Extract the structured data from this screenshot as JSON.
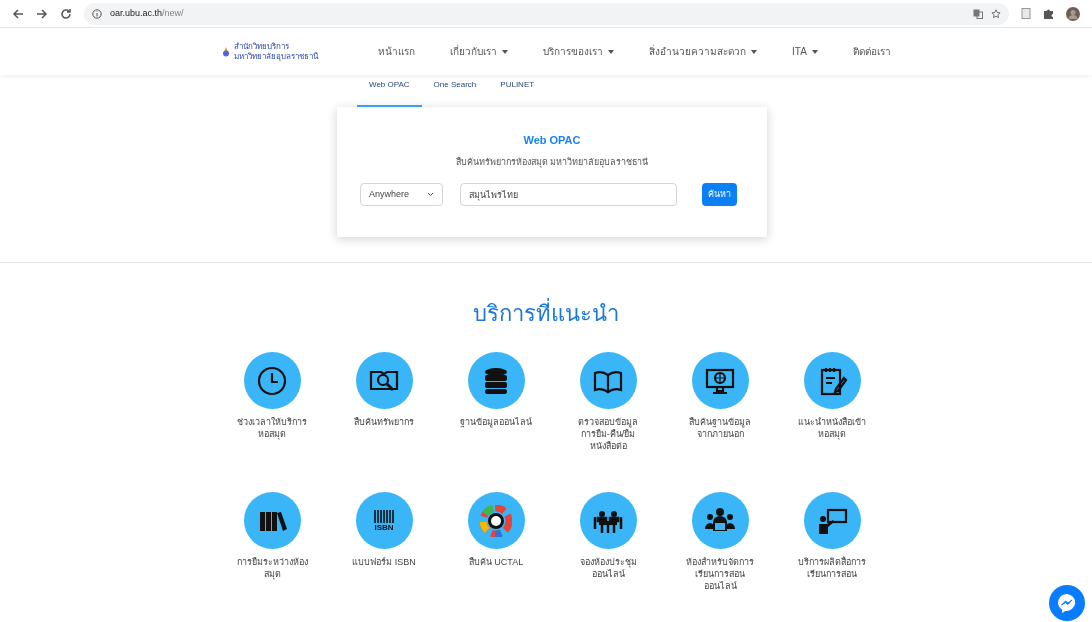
{
  "browser": {
    "url_host": "oar.ubu.ac.th",
    "url_path": "/new/"
  },
  "logo": {
    "line_1": "สำนักวิทยบริการ",
    "line_2": "มหาวิทยาลัยอุบลราชธานี"
  },
  "nav": [
    {
      "label": "หน้าแรก",
      "dropdown": false
    },
    {
      "label": "เกี่ยวกับเรา",
      "dropdown": true
    },
    {
      "label": "บริการของเรา",
      "dropdown": true
    },
    {
      "label": "สิ่งอำนวยความสะดวก",
      "dropdown": true
    },
    {
      "label": "ITA",
      "dropdown": true
    },
    {
      "label": "ติดต่อเรา",
      "dropdown": false
    }
  ],
  "search_tabs": [
    {
      "label": "Web OPAC",
      "selected": true
    },
    {
      "label": "One Search",
      "selected": false
    },
    {
      "label": "PULINET",
      "selected": false
    }
  ],
  "search_card": {
    "title": "Web OPAC",
    "subtitle": "สืบค้นทรัพยากรห้องสมุด มหาวิทยาลัยอุบลราชธานี",
    "scope": "Anywhere",
    "query": "สมุนไพรไทย",
    "button": "ค้นหา"
  },
  "services_heading": "บริการที่แนะนำ",
  "services": [
    {
      "kind": "clock",
      "label": "ช่วงเวลาให้บริการ\nหอสมุด"
    },
    {
      "kind": "book-search",
      "label": "สืบค้นทรัพยากร"
    },
    {
      "kind": "database",
      "label": "ฐานข้อมูลออนไลน์"
    },
    {
      "kind": "book",
      "label": "ตรวจสอบข้อมูล\nการยืม-คืน/ยืม\nหนังสือต่อ"
    },
    {
      "kind": "monitor",
      "label": "สืบค้นฐานข้อมูล\nจากภายนอก"
    },
    {
      "kind": "notepad",
      "label": "แนะนำหนังสือเข้า\nหอสมุด"
    },
    {
      "kind": "books",
      "label": "การยืมระหว่างห้อง\nสมุด"
    },
    {
      "kind": "barcode",
      "icon_text": "ISBN",
      "label": "แบบฟอร์ม ISBN"
    },
    {
      "kind": "ring",
      "label": "สืบค้น UCTAL"
    },
    {
      "kind": "meeting",
      "label": "จองห้องประชุม\nออนไลน์"
    },
    {
      "kind": "class",
      "label": "ห้องสำหรับจัดการ\nเรียนการสอน\nออนไลน์"
    },
    {
      "kind": "teacher",
      "label": "บริการผลิตสื่อการ\nเรียนการสอน"
    }
  ]
}
